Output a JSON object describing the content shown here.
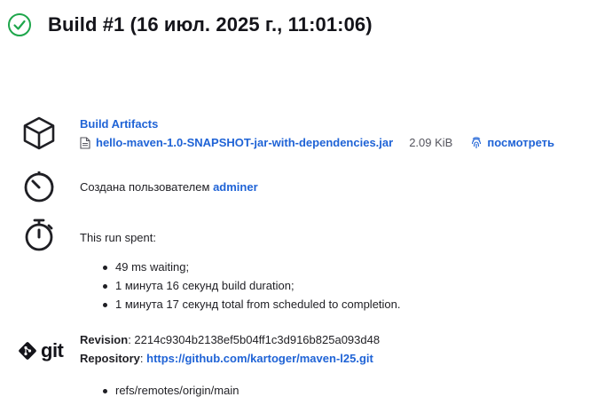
{
  "header": {
    "title": "Build #1 (16 июл. 2025 г., 11:01:06)",
    "status_icon": "check-circle-icon",
    "status_color": "#1ea64b"
  },
  "artifacts": {
    "title": "Build Artifacts",
    "file_name": "hello-maven-1.0-SNAPSHOT-jar-with-dependencies.jar",
    "file_size": "2.09 KiB",
    "view_label": "посмотреть"
  },
  "started_by": {
    "prefix": "Создана пользователем",
    "user": "adminer"
  },
  "timing": {
    "title": "This run spent:",
    "items": [
      "49 ms waiting;",
      "1 минута 16 секунд build duration;",
      "1 минута 17 секунд total from scheduled to completion."
    ]
  },
  "git": {
    "logo_text": "git",
    "revision_label": "Revision",
    "revision": "2214c9304b2138ef5b04ff1c3d916b825a093d48",
    "repository_label": "Repository",
    "repository_url": "https://github.com/kartoger/maven-l25.git",
    "branches": [
      "refs/remotes/origin/main"
    ]
  },
  "colors": {
    "link": "#1f63d6",
    "text": "#1f1f24"
  }
}
